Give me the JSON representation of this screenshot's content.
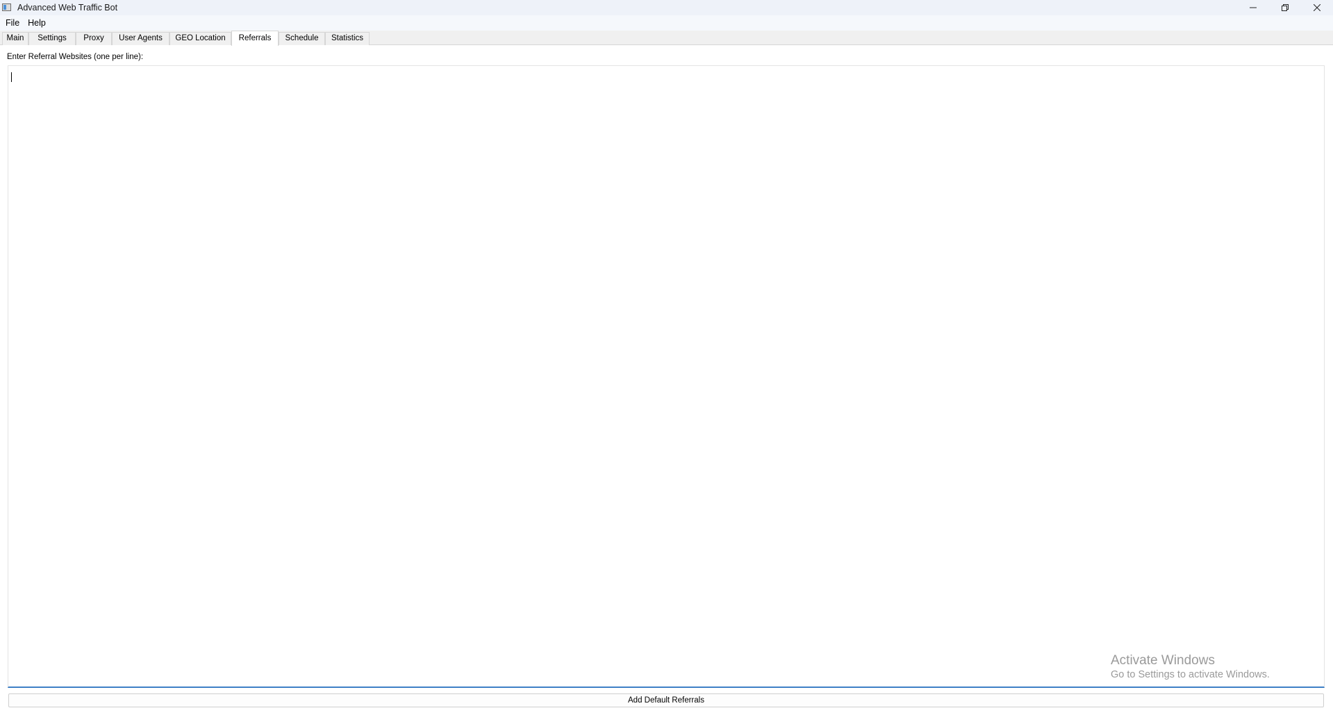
{
  "window": {
    "title": "Advanced Web Traffic Bot",
    "icon": "app-window-icon",
    "controls": [
      "minimize-icon",
      "restore-icon",
      "close-icon"
    ]
  },
  "menubar": {
    "items": [
      {
        "label": "File"
      },
      {
        "label": "Help"
      }
    ]
  },
  "tabs": {
    "items": [
      {
        "label": "Main"
      },
      {
        "label": "Settings"
      },
      {
        "label": "Proxy"
      },
      {
        "label": "User Agents"
      },
      {
        "label": "GEO Location"
      },
      {
        "label": "Referrals"
      },
      {
        "label": "Schedule"
      },
      {
        "label": "Statistics"
      }
    ],
    "active": "Referrals"
  },
  "referrals": {
    "label": "Enter Referral Websites (one per line):",
    "value": "",
    "add_default_button": "Add Default Referrals"
  },
  "watermark": {
    "title": "Activate Windows",
    "subtitle": "Go to Settings to activate Windows."
  },
  "colors": {
    "accent": "#3d7fc6",
    "titlebar": "#eef2f9",
    "background": "#f0f0f0"
  }
}
